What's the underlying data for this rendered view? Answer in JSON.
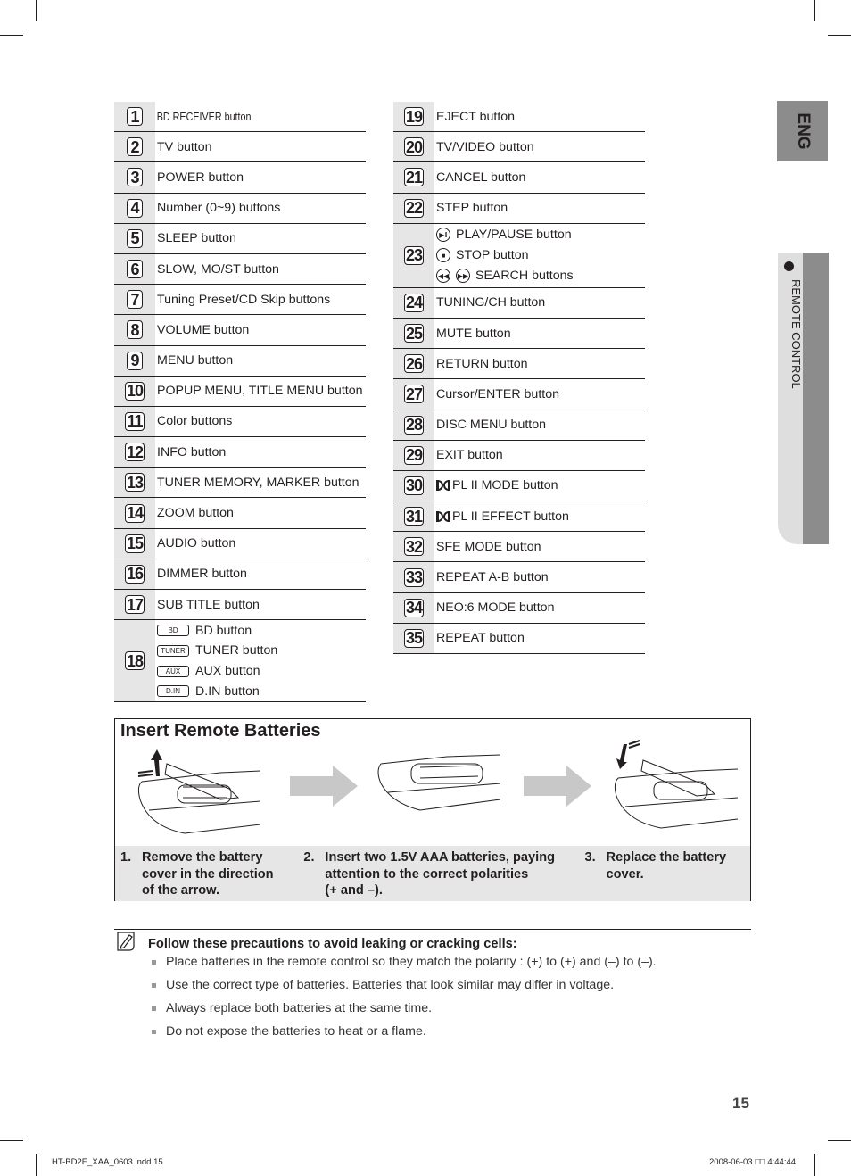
{
  "left_table": [
    {
      "num": "1",
      "label": "BD RECEIVER button"
    },
    {
      "num": "2",
      "label": "TV button"
    },
    {
      "num": "3",
      "label": "POWER button"
    },
    {
      "num": "4",
      "label": "Number (0~9) buttons"
    },
    {
      "num": "5",
      "label": "SLEEP button"
    },
    {
      "num": "6",
      "label": "SLOW, MO/ST button"
    },
    {
      "num": "7",
      "label": "Tuning Preset/CD Skip buttons"
    },
    {
      "num": "8",
      "label": "VOLUME button"
    },
    {
      "num": "9",
      "label": "MENU button"
    },
    {
      "num": "10",
      "label": "POPUP MENU, TITLE MENU button"
    },
    {
      "num": "11",
      "label": "Color buttons"
    },
    {
      "num": "12",
      "label": "INFO button"
    },
    {
      "num": "13",
      "label": "TUNER MEMORY, MARKER button"
    },
    {
      "num": "14",
      "label": "ZOOM button"
    },
    {
      "num": "15",
      "label": "AUDIO button"
    },
    {
      "num": "16",
      "label": "DIMMER button"
    },
    {
      "num": "17",
      "label": "SUB TITLE button"
    },
    {
      "num": "18",
      "items": [
        {
          "key": "BD",
          "label": "BD button"
        },
        {
          "key": "TUNER",
          "label": "TUNER button"
        },
        {
          "key": "AUX",
          "label": "AUX button"
        },
        {
          "key": "D.IN",
          "label": "D.IN button"
        }
      ]
    }
  ],
  "right_table": [
    {
      "num": "19",
      "label": "EJECT button"
    },
    {
      "num": "20",
      "label": "TV/VIDEO button"
    },
    {
      "num": "21",
      "label": "CANCEL button"
    },
    {
      "num": "22",
      "label": "STEP button"
    },
    {
      "num": "23",
      "items": [
        {
          "icons": [
            "play-pause-icon"
          ],
          "glyphs": [
            "▶‖"
          ],
          "label": "PLAY/PAUSE button"
        },
        {
          "icons": [
            "stop-icon"
          ],
          "glyphs": [
            "■"
          ],
          "label": "STOP button"
        },
        {
          "icons": [
            "rewind-icon",
            "fast-forward-icon"
          ],
          "glyphs": [
            "◀◀",
            "▶▶"
          ],
          "label": "SEARCH buttons"
        }
      ]
    },
    {
      "num": "24",
      "label": "TUNING/CH button"
    },
    {
      "num": "25",
      "label": "MUTE button"
    },
    {
      "num": "26",
      "label": "RETURN button"
    },
    {
      "num": "27",
      "label": "Cursor/ENTER button"
    },
    {
      "num": "28",
      "label": "DISC MENU button"
    },
    {
      "num": "29",
      "label": "EXIT button"
    },
    {
      "num": "30",
      "label": "PL II MODE button",
      "dolby": true
    },
    {
      "num": "31",
      "label": "PL II EFFECT button",
      "dolby": true
    },
    {
      "num": "32",
      "label": "SFE MODE button"
    },
    {
      "num": "33",
      "label": "REPEAT A-B button"
    },
    {
      "num": "34",
      "label": "NEO:6 MODE button"
    },
    {
      "num": "35",
      "label": "REPEAT button"
    }
  ],
  "side_tabs": {
    "language": "ENG",
    "section": "REMOTE CONTROL"
  },
  "batteries": {
    "title": "Insert Remote Batteries",
    "steps": [
      {
        "n": "1.",
        "text": [
          "Remove the battery",
          "cover in the direction",
          "of the arrow."
        ]
      },
      {
        "n": "2.",
        "text": [
          "Insert two 1.5V AAA batteries, paying",
          "attention to the correct polarities",
          "(+ and –)."
        ]
      },
      {
        "n": "3.",
        "text": [
          "Replace the battery",
          "cover."
        ]
      }
    ]
  },
  "note": {
    "title": "Follow these precautions to avoid leaking or cracking cells:",
    "items": [
      "Place batteries in the remote control so they match the polarity : (+) to (+) and (–) to (–).",
      "Use the correct type of batteries. Batteries that look similar may differ in voltage.",
      "Always replace both batteries at the same time.",
      "Do not expose the batteries to heat or a flame."
    ]
  },
  "page_number": "15",
  "footer": {
    "file": "HT-BD2E_XAA_0603.indd   15",
    "timestamp": "2008-06-03   □□ 4:44:44"
  }
}
